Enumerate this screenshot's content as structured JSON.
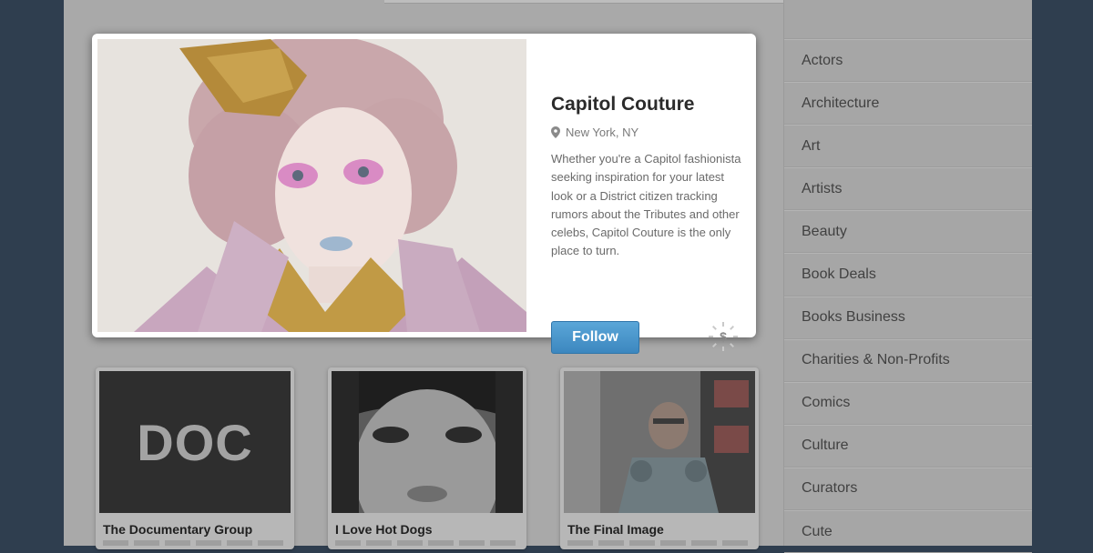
{
  "featured": {
    "title": "Capitol Couture",
    "location": "New York, NY",
    "description": "Whether you're a Capitol fashionista seeking inspiration for your latest look or a District citizen tracking rumors about the Tributes and other celebs, Capitol Couture is the only place to turn.",
    "follow_label": "Follow",
    "sponsor_symbol": "$"
  },
  "cards": [
    {
      "title": "The Documentary Group",
      "thumb_text": "DOC"
    },
    {
      "title": "I Love Hot Dogs"
    },
    {
      "title": "The Final Image"
    }
  ],
  "sidebar": {
    "categories": [
      "Actors",
      "Architecture",
      "Art",
      "Artists",
      "Beauty",
      "Book Deals",
      "Books Business",
      "Charities & Non-Profits",
      "Comics",
      "Culture",
      "Curators",
      "Cute"
    ]
  },
  "colors": {
    "follow_button": "#4a97cf",
    "background": "#2f3e4f"
  }
}
